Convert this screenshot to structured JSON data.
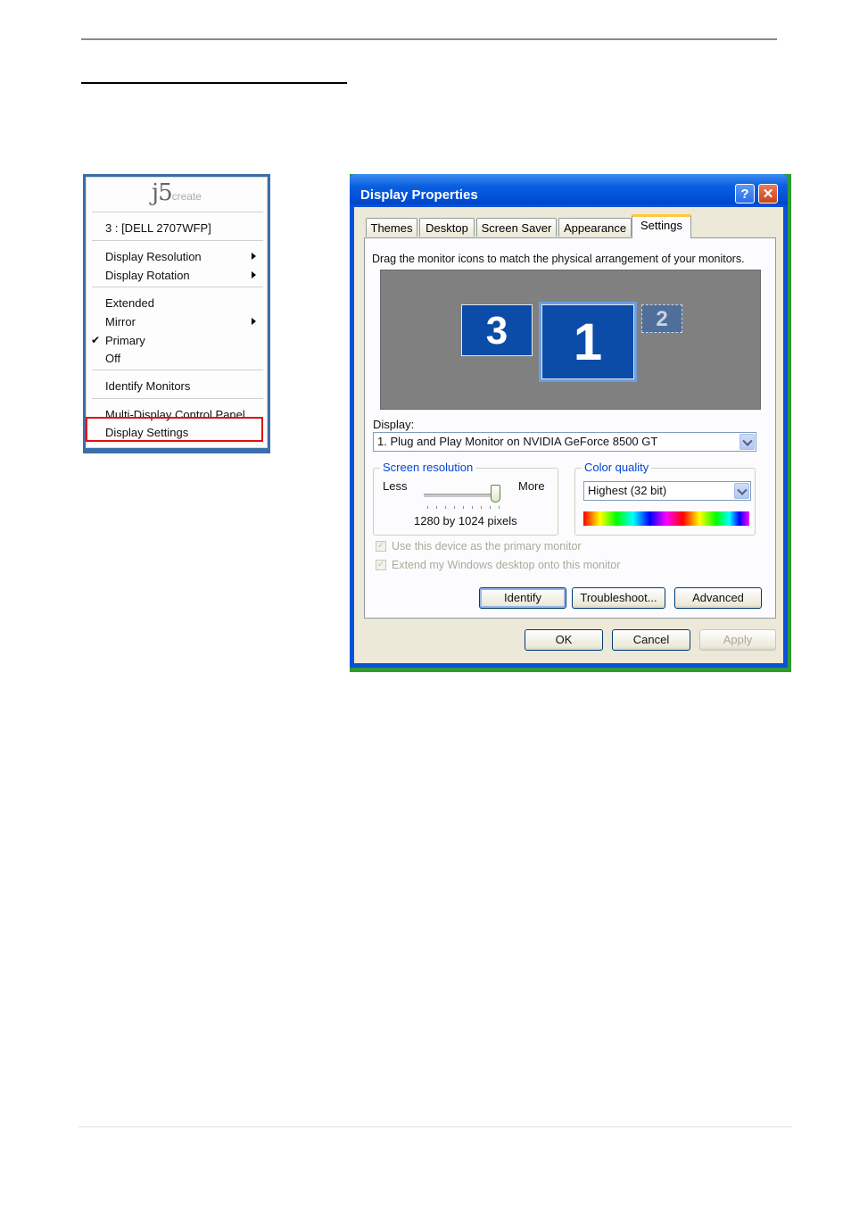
{
  "menu": {
    "logo_main": "j5",
    "logo_sub": "create",
    "device": "3 : [DELL 2707WFP]",
    "items": [
      {
        "label": "Display Resolution"
      },
      {
        "label": "Display Rotation"
      },
      {
        "label": "Extended"
      },
      {
        "label": "Mirror"
      },
      {
        "label": "Primary",
        "checked": true
      },
      {
        "label": "Off"
      },
      {
        "label": "Identify Monitors"
      },
      {
        "label": "Multi-Display Control Panel"
      },
      {
        "label": "Display Settings"
      }
    ],
    "highlight_color": "#e01010"
  },
  "dialog": {
    "title": "Display Properties",
    "help_label": "?",
    "close_label": "✕",
    "tabs": [
      "Themes",
      "Desktop",
      "Screen Saver",
      "Appearance",
      "Settings"
    ],
    "active_tab": "Settings",
    "instruction": "Drag the monitor icons to match the physical arrangement of your monitors.",
    "monitors": [
      "3",
      "1",
      "2"
    ],
    "display_label": "Display:",
    "display_value": "1. Plug and Play Monitor on NVIDIA GeForce 8500 GT",
    "resolution": {
      "title": "Screen resolution",
      "less": "Less",
      "more": "More",
      "value": "1280 by 1024 pixels"
    },
    "color_quality": {
      "title": "Color quality",
      "value": "Highest (32 bit)"
    },
    "checkboxes": [
      {
        "label": "Use this device as the primary monitor",
        "checked": true
      },
      {
        "label": "Extend my Windows desktop onto this monitor",
        "checked": true
      }
    ],
    "buttons": {
      "identify": "Identify",
      "troubleshoot": "Troubleshoot...",
      "advanced": "Advanced",
      "ok": "OK",
      "cancel": "Cancel",
      "apply": "Apply"
    },
    "colors": {
      "titlebar": "#0050d8",
      "face": "#ece9d8",
      "monitor": "#0a4ca8"
    }
  }
}
